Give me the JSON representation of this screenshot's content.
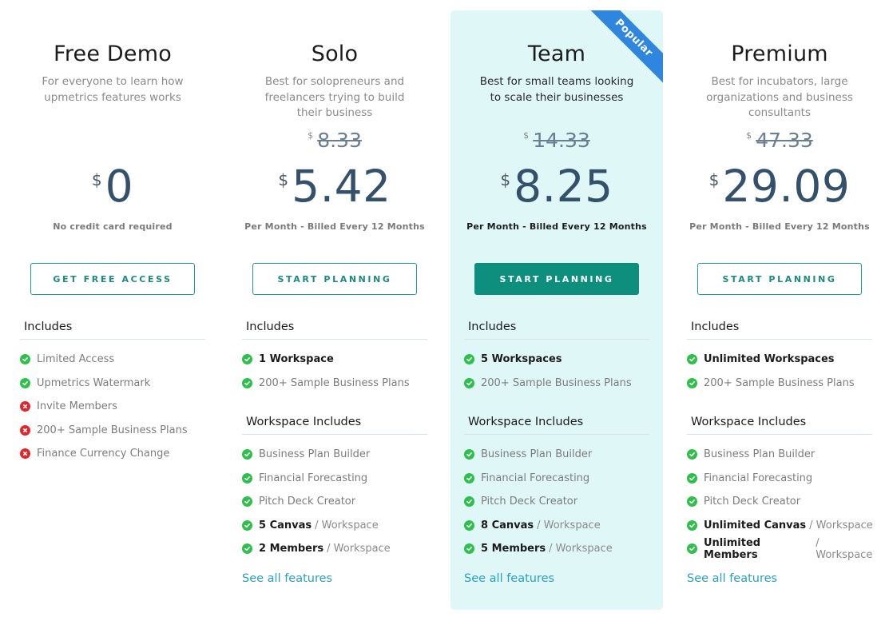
{
  "plans": [
    {
      "name": "Free Demo",
      "description": "For everyone to learn how upmetrics features works",
      "old_price": null,
      "currency": "$",
      "price": "0",
      "billing": "No credit card required",
      "cta": "GET FREE ACCESS",
      "featured": false,
      "ribbon": null,
      "includes_title": "Includes",
      "includes": [
        {
          "icon": "check-icon",
          "strong": "",
          "text": "Limited Access"
        },
        {
          "icon": "check-icon",
          "strong": "",
          "text": "Upmetrics Watermark"
        },
        {
          "icon": "cross-icon",
          "strong": "",
          "text": "Invite Members"
        },
        {
          "icon": "cross-icon",
          "strong": "",
          "text": "200+ Sample Business Plans"
        },
        {
          "icon": "cross-icon",
          "strong": "",
          "text": "Finance Currency Change"
        }
      ],
      "workspace_title": null,
      "workspace_includes": [],
      "see_all": null
    },
    {
      "name": "Solo",
      "description": "Best for solopreneurs and freelancers trying to build their business",
      "old_price": "8.33",
      "currency": "$",
      "price": "5.42",
      "billing": "Per Month - Billed Every 12 Months",
      "cta": "START PLANNING",
      "featured": false,
      "ribbon": null,
      "includes_title": "Includes",
      "includes": [
        {
          "icon": "check-icon",
          "strong": "1 Workspace",
          "text": ""
        },
        {
          "icon": "check-icon",
          "strong": "",
          "text": "200+ Sample Business Plans"
        }
      ],
      "workspace_title": "Workspace Includes",
      "workspace_includes": [
        {
          "icon": "check-icon",
          "strong": "",
          "text": "Business Plan Builder"
        },
        {
          "icon": "check-icon",
          "strong": "",
          "text": "Financial Forecasting"
        },
        {
          "icon": "check-icon",
          "strong": "",
          "text": "Pitch Deck Creator"
        },
        {
          "icon": "check-icon",
          "strong": "5 Canvas",
          "text": "/ Workspace"
        },
        {
          "icon": "check-icon",
          "strong": "2 Members",
          "text": "/ Workspace"
        }
      ],
      "see_all": "See all features"
    },
    {
      "name": "Team",
      "description": "Best for small teams looking to scale their businesses",
      "old_price": "14.33",
      "currency": "$",
      "price": "8.25",
      "billing": "Per Month - Billed Every 12 Months",
      "cta": "START PLANNING",
      "featured": true,
      "ribbon": "Popular",
      "includes_title": "Includes",
      "includes": [
        {
          "icon": "check-icon",
          "strong": "5 Workspaces",
          "text": ""
        },
        {
          "icon": "check-icon",
          "strong": "",
          "text": "200+ Sample Business Plans"
        }
      ],
      "workspace_title": "Workspace Includes",
      "workspace_includes": [
        {
          "icon": "check-icon",
          "strong": "",
          "text": "Business Plan Builder"
        },
        {
          "icon": "check-icon",
          "strong": "",
          "text": "Financial Forecasting"
        },
        {
          "icon": "check-icon",
          "strong": "",
          "text": "Pitch Deck Creator"
        },
        {
          "icon": "check-icon",
          "strong": "8 Canvas",
          "text": "/ Workspace"
        },
        {
          "icon": "check-icon",
          "strong": "5 Members",
          "text": "/ Workspace"
        }
      ],
      "see_all": "See all features"
    },
    {
      "name": "Premium",
      "description": "Best for incubators, large organizations and business consultants",
      "old_price": "47.33",
      "currency": "$",
      "price": "29.09",
      "billing": "Per Month - Billed Every 12 Months",
      "cta": "START PLANNING",
      "featured": false,
      "ribbon": null,
      "includes_title": "Includes",
      "includes": [
        {
          "icon": "check-icon",
          "strong": "Unlimited Workspaces",
          "text": ""
        },
        {
          "icon": "check-icon",
          "strong": "",
          "text": "200+ Sample Business Plans"
        }
      ],
      "workspace_title": "Workspace Includes",
      "workspace_includes": [
        {
          "icon": "check-icon",
          "strong": "",
          "text": "Business Plan Builder"
        },
        {
          "icon": "check-icon",
          "strong": "",
          "text": "Financial Forecasting"
        },
        {
          "icon": "check-icon",
          "strong": "",
          "text": "Pitch Deck Creator"
        },
        {
          "icon": "check-icon",
          "strong": "Unlimited Canvas",
          "text": "/ Workspace"
        },
        {
          "icon": "check-icon",
          "strong": "Unlimited Members",
          "text": "/ Workspace"
        }
      ],
      "see_all": "See all features"
    }
  ],
  "colors": {
    "accent": "#1f9e8e",
    "featured_bg": "#dff7f6",
    "ribbon": "#2e86de",
    "price": "#34506b",
    "check": "#2fbf4c",
    "cross": "#e3242b",
    "link": "#2a9fbf"
  }
}
